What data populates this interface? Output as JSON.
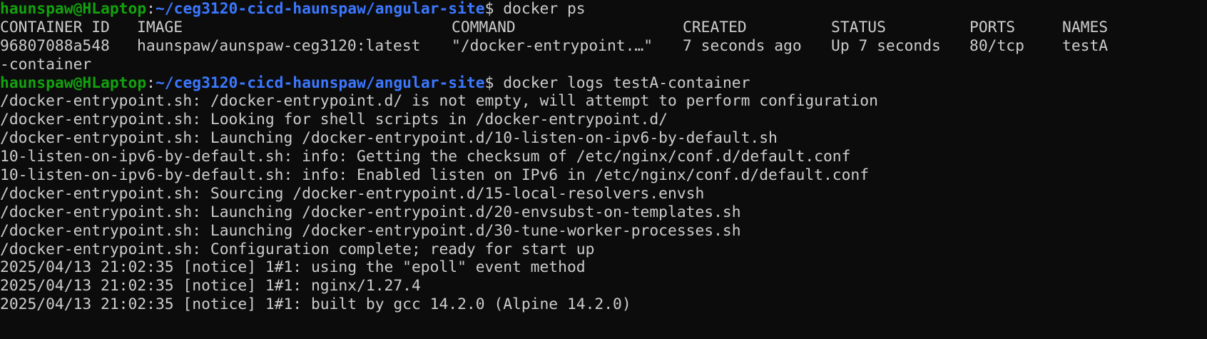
{
  "prompt": {
    "user_host": "haunspaw@HLaptop",
    "separator": ":",
    "path": "~/ceg3120-cicd-haunspaw/angular-site",
    "dollar": "$"
  },
  "commands": {
    "first": "docker ps",
    "second": "docker logs testA-container"
  },
  "ps_table": {
    "headers": [
      "CONTAINER ID",
      "IMAGE",
      "COMMAND",
      "CREATED",
      "STATUS",
      "PORTS",
      "NAMES"
    ],
    "row": [
      "96807088a548",
      "haunspaw/aunspaw-ceg3120:latest",
      "\"/docker-entrypoint.…\"",
      "7 seconds ago",
      "Up 7 seconds",
      "80/tcp",
      "testA"
    ],
    "wrap": "-container"
  },
  "log_lines": [
    "/docker-entrypoint.sh: /docker-entrypoint.d/ is not empty, will attempt to perform configuration",
    "/docker-entrypoint.sh: Looking for shell scripts in /docker-entrypoint.d/",
    "/docker-entrypoint.sh: Launching /docker-entrypoint.d/10-listen-on-ipv6-by-default.sh",
    "10-listen-on-ipv6-by-default.sh: info: Getting the checksum of /etc/nginx/conf.d/default.conf",
    "10-listen-on-ipv6-by-default.sh: info: Enabled listen on IPv6 in /etc/nginx/conf.d/default.conf",
    "/docker-entrypoint.sh: Sourcing /docker-entrypoint.d/15-local-resolvers.envsh",
    "/docker-entrypoint.sh: Launching /docker-entrypoint.d/20-envsubst-on-templates.sh",
    "/docker-entrypoint.sh: Launching /docker-entrypoint.d/30-tune-worker-processes.sh",
    "/docker-entrypoint.sh: Configuration complete; ready for start up",
    "2025/04/13 21:02:35 [notice] 1#1: using the \"epoll\" event method",
    "2025/04/13 21:02:35 [notice] 1#1: nginx/1.27.4",
    "2025/04/13 21:02:35 [notice] 1#1: built by gcc 14.2.0 (Alpine 14.2.0)"
  ],
  "colors": {
    "background": "#0c0c0c",
    "text": "#cccccc",
    "user_host": "#13a10e",
    "path": "#3b78ff"
  }
}
